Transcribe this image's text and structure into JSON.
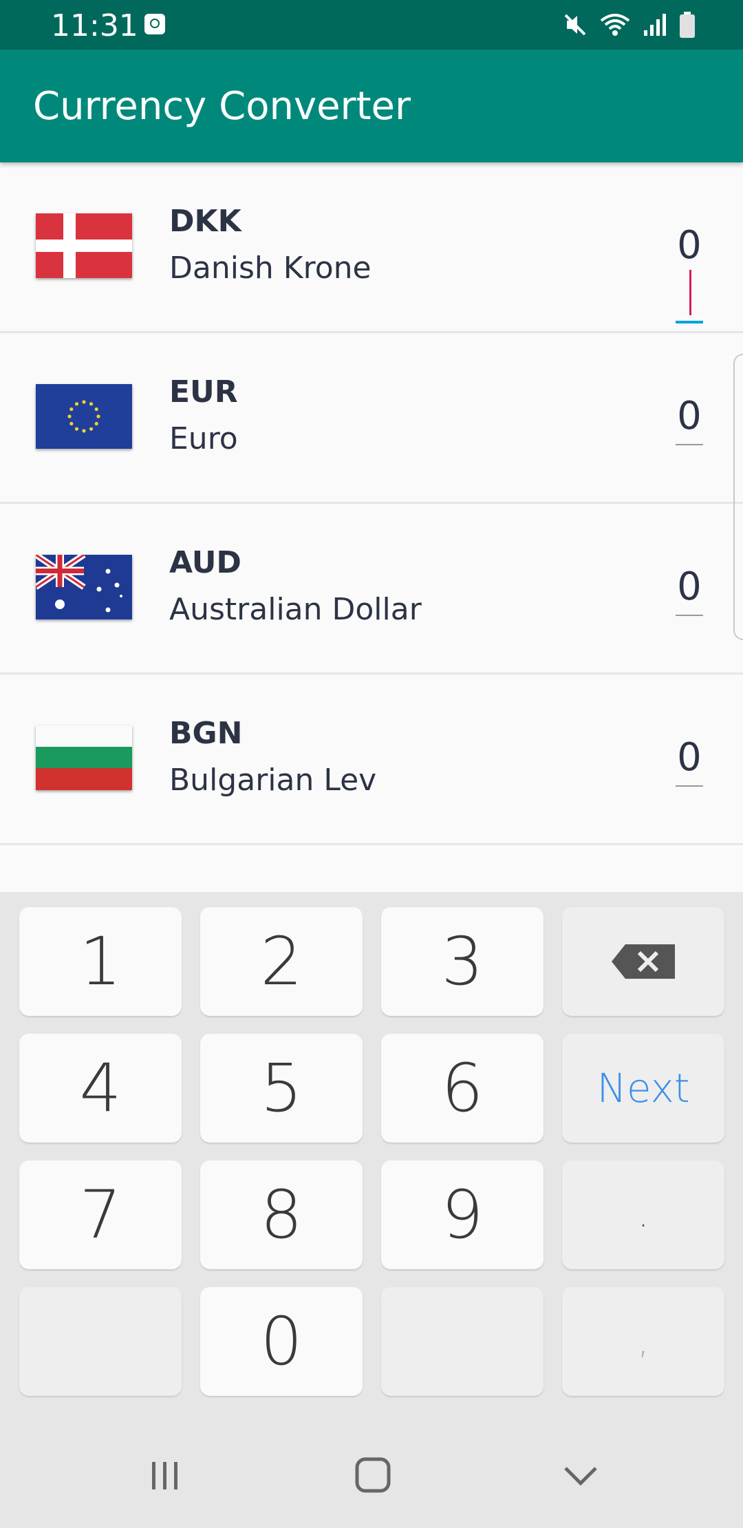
{
  "status_bar": {
    "time": "11:31"
  },
  "app": {
    "title": "Currency Converter"
  },
  "currencies": [
    {
      "code": "DKK",
      "name": "Danish Krone",
      "amount": "0",
      "flag": "denmark-flag",
      "focused": true
    },
    {
      "code": "EUR",
      "name": "Euro",
      "amount": "0",
      "flag": "eu-flag"
    },
    {
      "code": "AUD",
      "name": "Australian Dollar",
      "amount": "0",
      "flag": "australia-flag"
    },
    {
      "code": "BGN",
      "name": "Bulgarian Lev",
      "amount": "0",
      "flag": "bulgaria-flag"
    }
  ],
  "keyboard": {
    "keys": [
      "1",
      "2",
      "3",
      "4",
      "5",
      "6",
      "7",
      "8",
      "9",
      "0"
    ],
    "next_label": "Next",
    "dot_label": ".",
    "comma_label": ","
  },
  "colors": {
    "status_bar": "#00695c",
    "app_bar": "#00897b",
    "accent": "#00a3d9",
    "cursor": "#d81b60",
    "next": "#3d8fe8"
  }
}
